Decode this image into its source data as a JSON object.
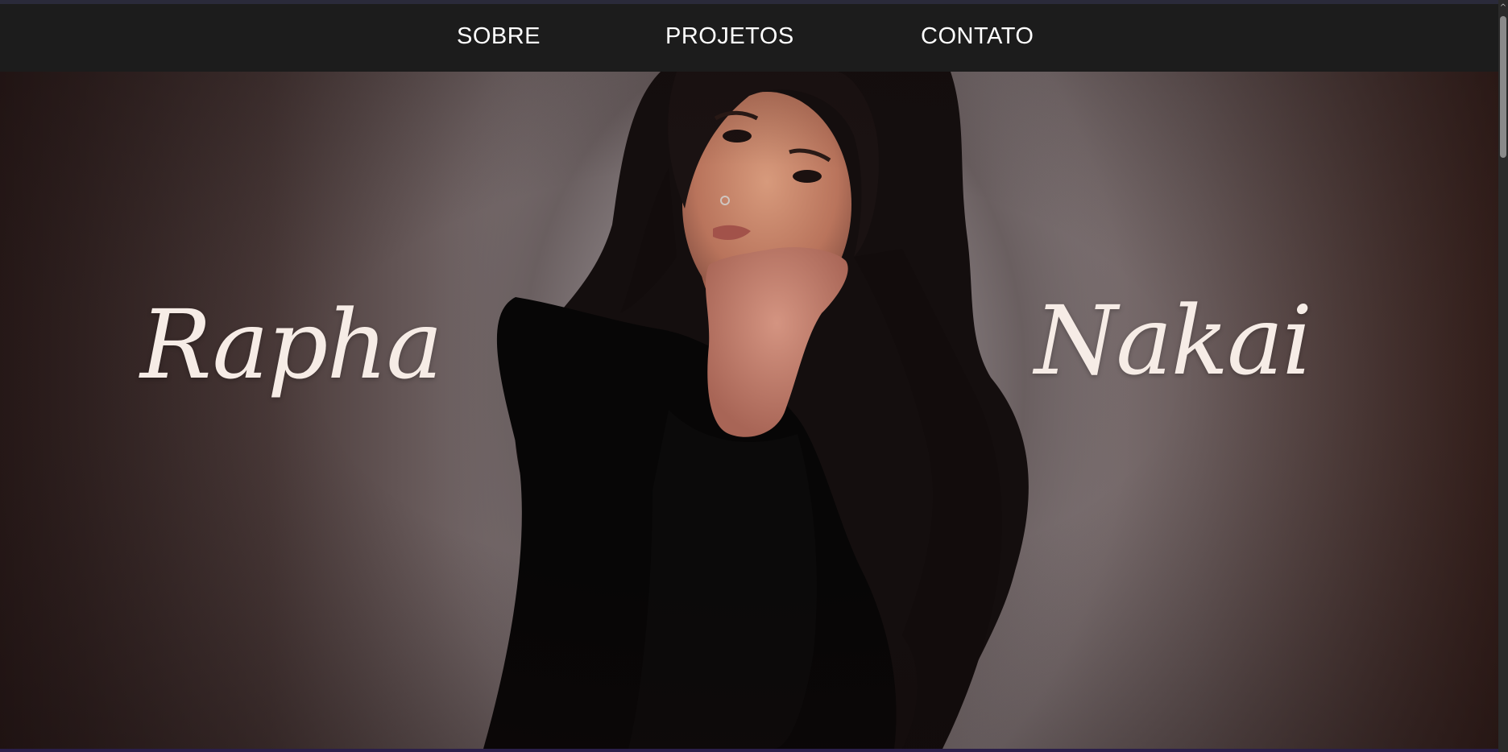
{
  "nav": {
    "items": [
      {
        "label": "SOBRE"
      },
      {
        "label": "PROJETOS"
      },
      {
        "label": "CONTATO"
      }
    ]
  },
  "hero": {
    "first_name": "Rapha",
    "last_name": "Nakai",
    "photo_icon": "portrait-photo"
  },
  "colors": {
    "nav_background": "#1c1c1c",
    "nav_text": "#ffffff",
    "name_text": "#f6ece6"
  }
}
